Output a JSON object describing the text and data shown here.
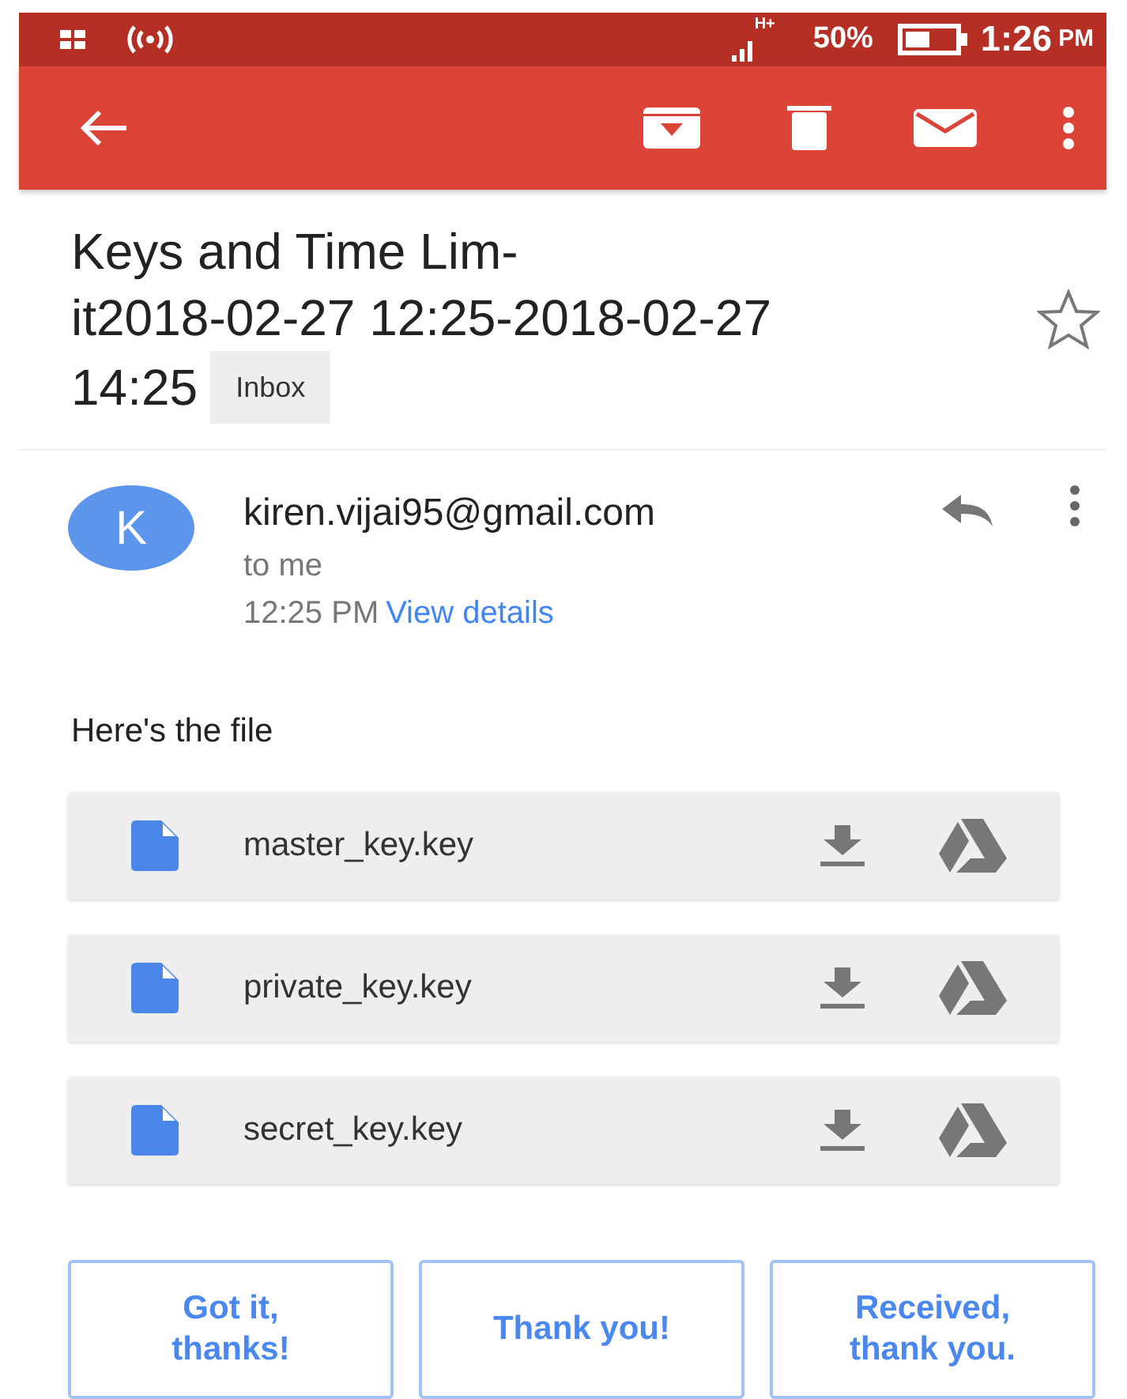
{
  "status_bar": {
    "network": "H+",
    "battery": "50%",
    "time": "1:26",
    "ampm": "PM"
  },
  "subject": {
    "title_lines": [
      "Keys and Time Lim-",
      "it2018-02-27 12:25-2018-02-27",
      "14:25"
    ],
    "label": "Inbox",
    "starred": false
  },
  "message": {
    "avatar": "K",
    "sender": "kiren.vijai95@gmail.com",
    "recipient": "to me",
    "time": "12:25 PM",
    "details_link": "View details",
    "body": "Here's the file"
  },
  "attachments": [
    {
      "name": "master_key.key"
    },
    {
      "name": "private_key.key"
    },
    {
      "name": "secret_key.key"
    }
  ],
  "smart_replies": [
    "Got it,\nthanks!",
    "Thank you!",
    "Received,\nthank you."
  ]
}
